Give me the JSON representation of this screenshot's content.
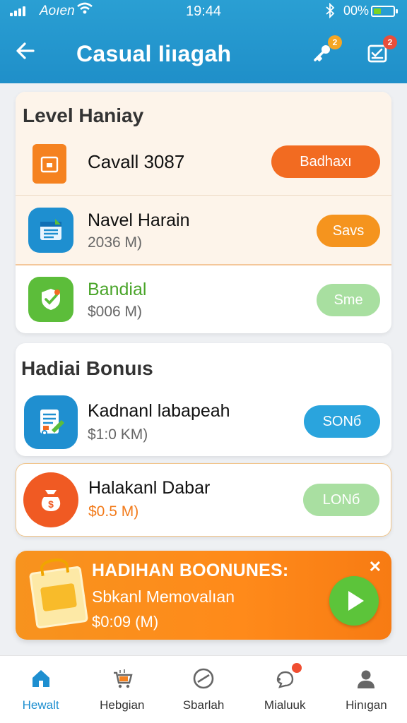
{
  "status_bar": {
    "carrier": "Aoıen",
    "time": "19:44",
    "battery": "00%",
    "battery_level": 0.4
  },
  "app_bar": {
    "title": "Casual Iiıagah",
    "back_icon": "arrow-left-icon",
    "actions": [
      {
        "icon": "key-icon",
        "badge": "2",
        "badge_color": "#f5a623"
      },
      {
        "icon": "task-list-icon",
        "badge": "2",
        "badge_color": "#e94e3c"
      }
    ]
  },
  "level_section": {
    "title": "Level Haniay",
    "items": [
      {
        "name": "Cavall 3087",
        "sub": "",
        "button": "Badhaxı",
        "icon": "box-icon",
        "icon_bg": "#f58220",
        "button_color": "#f26b21",
        "name_color": "#111111"
      },
      {
        "name": "Navel Harain",
        "sub": "2036 M)",
        "button": "Savs",
        "icon": "calendar-icon",
        "icon_bg": "#1e8fd0",
        "button_color": "#f5941e",
        "name_color": "#111111"
      },
      {
        "name": "Bandial",
        "sub": "$006 M)",
        "button": "Sme",
        "icon": "check-shield-icon",
        "icon_bg": "#5cbd3a",
        "button_color": "#a8dfa0",
        "name_color": "#4aa52a"
      }
    ]
  },
  "bonus_section": {
    "title": "Hadiai Bonuıs",
    "items": [
      {
        "name": "Kadnanl labapeah",
        "sub": "$1:0 KM)",
        "button": "SONб",
        "icon": "document-icon",
        "icon_bg": "#1f8fd0",
        "button_color": "#2aa4dd",
        "sub_color": "#666666"
      },
      {
        "name": "Halakanl Dabar",
        "sub": "$0.5 M)",
        "button": "LONб",
        "icon": "money-bag-icon",
        "icon_bg": "#f05a23",
        "button_color": "#a9dfa1",
        "sub_color": "#f27a1a"
      }
    ]
  },
  "promo": {
    "title": "HADIHAN BOONUNES:",
    "subtitle": "Sbkanl Memovalıan",
    "amount": "$0:09 (M)",
    "close_icon": "close-icon",
    "action_icon": "play-icon",
    "image_icon": "gift-box-icon"
  },
  "bottom_nav": {
    "items": [
      {
        "label": "Hewalt",
        "icon": "home-icon",
        "active": true
      },
      {
        "label": "Hebgian",
        "icon": "cart-icon",
        "active": false
      },
      {
        "label": "Sbarlah",
        "icon": "no-entry-icon",
        "active": false
      },
      {
        "label": "Mialuuk",
        "icon": "chat-icon",
        "active": false,
        "badge": true
      },
      {
        "label": "Hinıgan",
        "icon": "person-icon",
        "active": false
      }
    ]
  },
  "colors": {
    "primary": "#1f8fc9",
    "accent_orange": "#f26b21",
    "accent_green": "#5cc43a"
  }
}
